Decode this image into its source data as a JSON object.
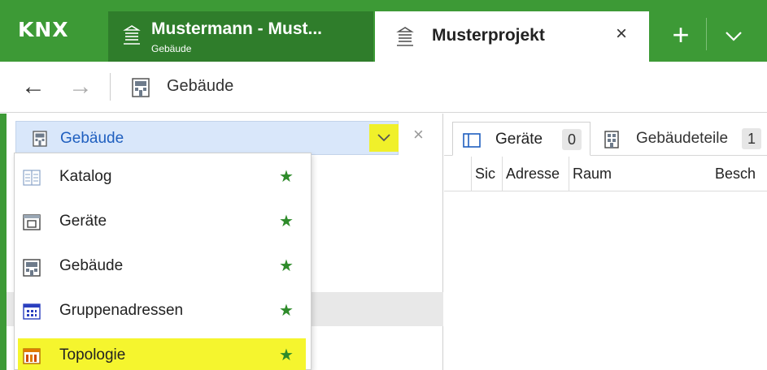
{
  "titlebar": {
    "logo": "KNX",
    "tab_project": {
      "title": "Mustermann - Must...",
      "subtitle": "Gebäude"
    },
    "tab_active": {
      "title": "Musterprojekt",
      "close": "×"
    },
    "plus": "+"
  },
  "navbar": {
    "back": "←",
    "forward": "→",
    "location": "Gebäude"
  },
  "left_panel": {
    "selector_label": "Gebäude",
    "close": "×",
    "menu_items": [
      {
        "label": "Katalog",
        "icon": "catalog-icon",
        "favorite": true
      },
      {
        "label": "Geräte",
        "icon": "devices-icon",
        "favorite": true
      },
      {
        "label": "Gebäude",
        "icon": "building-icon",
        "favorite": true
      },
      {
        "label": "Gruppenadressen",
        "icon": "group-addresses-icon",
        "favorite": true
      },
      {
        "label": "Topologie",
        "icon": "topology-icon",
        "favorite": true,
        "highlighted": true
      }
    ],
    "star": "★"
  },
  "right_panel": {
    "tabs": [
      {
        "label": "Geräte",
        "count": "0"
      },
      {
        "label": "Gebäudeteile",
        "count": "1"
      }
    ],
    "columns": [
      "Sic",
      "Adresse",
      "Raum",
      "Besch"
    ]
  },
  "colors": {
    "brand_green": "#3d9a36",
    "dark_green": "#2f7d2b",
    "highlight_yellow": "#f5f52e",
    "selector_blue": "#d9e7fa",
    "star_green": "#2e8b2a"
  }
}
